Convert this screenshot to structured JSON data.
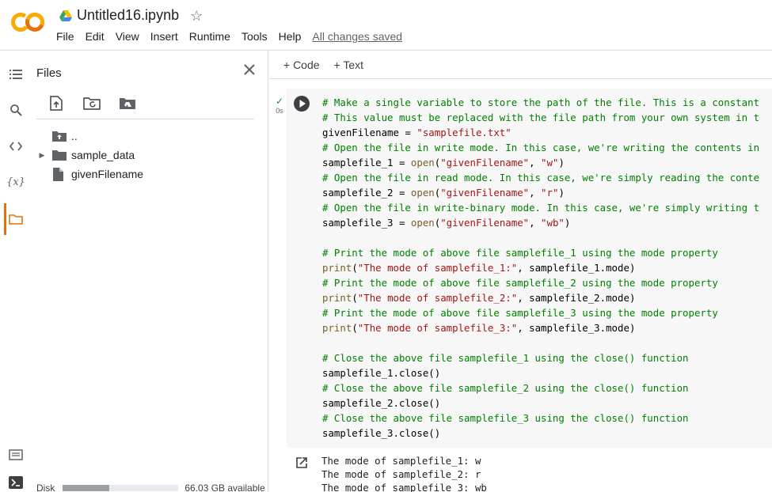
{
  "header": {
    "title": "Untitled16.ipynb",
    "menu": [
      "File",
      "Edit",
      "View",
      "Insert",
      "Runtime",
      "Tools",
      "Help"
    ],
    "save_status": "All changes saved"
  },
  "rail": {
    "icons": [
      "menu-icon",
      "search-icon",
      "code-icon",
      "variables-icon",
      "folder-icon",
      "command-palette-icon",
      "terminal-icon"
    ],
    "variables_glyph": "{x}"
  },
  "files": {
    "title": "Files",
    "toolbar": [
      "upload-icon",
      "refresh-icon",
      "drive-mount-icon"
    ],
    "tree": [
      {
        "name": "..",
        "kind": "parent"
      },
      {
        "name": "sample_data",
        "kind": "folder"
      },
      {
        "name": "givenFilename",
        "kind": "file"
      }
    ],
    "disk": {
      "label": "Disk",
      "available": "66.03 GB available",
      "used_fraction": 0.4
    }
  },
  "notebook": {
    "toolbar": {
      "code": "+ Code",
      "text": "+ Text"
    },
    "cell": {
      "status_time": "0s",
      "code_lines": [
        [
          [
            "c",
            "# Make a single variable to store the path of the file. This is a constant"
          ]
        ],
        [
          [
            "c",
            "# This value must be replaced with the file path from your own system in t"
          ]
        ],
        [
          [
            "n",
            "givenFilename = "
          ],
          [
            "s",
            "\"samplefile.txt\""
          ]
        ],
        [
          [
            "c",
            "# Open the file in write mode. In this case, we're writing the contents in"
          ]
        ],
        [
          [
            "n",
            "samplefile_1 = "
          ],
          [
            "f",
            "open"
          ],
          [
            "n",
            "("
          ],
          [
            "s",
            "\"givenFilename\""
          ],
          [
            "n",
            ", "
          ],
          [
            "s",
            "\"w\""
          ],
          [
            "n",
            ")"
          ]
        ],
        [
          [
            "c",
            "# Open the file in read mode. In this case, we're simply reading the conte"
          ]
        ],
        [
          [
            "n",
            "samplefile_2 = "
          ],
          [
            "f",
            "open"
          ],
          [
            "n",
            "("
          ],
          [
            "s",
            "\"givenFilename\""
          ],
          [
            "n",
            ", "
          ],
          [
            "s",
            "\"r\""
          ],
          [
            "n",
            ")"
          ]
        ],
        [
          [
            "c",
            "# Open the file in write-binary mode. In this case, we're simply writing t"
          ]
        ],
        [
          [
            "n",
            "samplefile_3 = "
          ],
          [
            "f",
            "open"
          ],
          [
            "n",
            "("
          ],
          [
            "s",
            "\"givenFilename\""
          ],
          [
            "n",
            ", "
          ],
          [
            "s",
            "\"wb\""
          ],
          [
            "n",
            ")"
          ]
        ],
        [
          [
            "n",
            ""
          ]
        ],
        [
          [
            "c",
            "# Print the mode of above file samplefile_1 using the mode property"
          ]
        ],
        [
          [
            "f",
            "print"
          ],
          [
            "n",
            "("
          ],
          [
            "s",
            "\"The mode of samplefile_1:\""
          ],
          [
            "n",
            ", samplefile_1.mode)"
          ]
        ],
        [
          [
            "c",
            "# Print the mode of above file samplefile_2 using the mode property"
          ]
        ],
        [
          [
            "f",
            "print"
          ],
          [
            "n",
            "("
          ],
          [
            "s",
            "\"The mode of samplefile_2:\""
          ],
          [
            "n",
            ", samplefile_2.mode)"
          ]
        ],
        [
          [
            "c",
            "# Print the mode of above file samplefile_3 using the mode property"
          ]
        ],
        [
          [
            "f",
            "print"
          ],
          [
            "n",
            "("
          ],
          [
            "s",
            "\"The mode of samplefile_3:\""
          ],
          [
            "n",
            ", samplefile_3.mode)"
          ]
        ],
        [
          [
            "n",
            ""
          ]
        ],
        [
          [
            "c",
            "# Close the above file samplefile_1 using the close() function"
          ]
        ],
        [
          [
            "n",
            "samplefile_1.close()"
          ]
        ],
        [
          [
            "c",
            "# Close the above file samplefile_2 using the close() function"
          ]
        ],
        [
          [
            "n",
            "samplefile_2.close()"
          ]
        ],
        [
          [
            "c",
            "# Close the above file samplefile_3 using the close() function"
          ]
        ],
        [
          [
            "n",
            "samplefile_3.close()"
          ]
        ]
      ],
      "output_lines": [
        "The mode of samplefile_1: w",
        "The mode of samplefile_2: r",
        "The mode of samplefile_3: wb"
      ]
    }
  },
  "colors": {
    "logo_orange": "#f9ab00",
    "logo_orange_dark": "#e8710a",
    "comment": "#008000",
    "string": "#a31515",
    "function": "#795e26",
    "success": "#1e8e3e"
  }
}
